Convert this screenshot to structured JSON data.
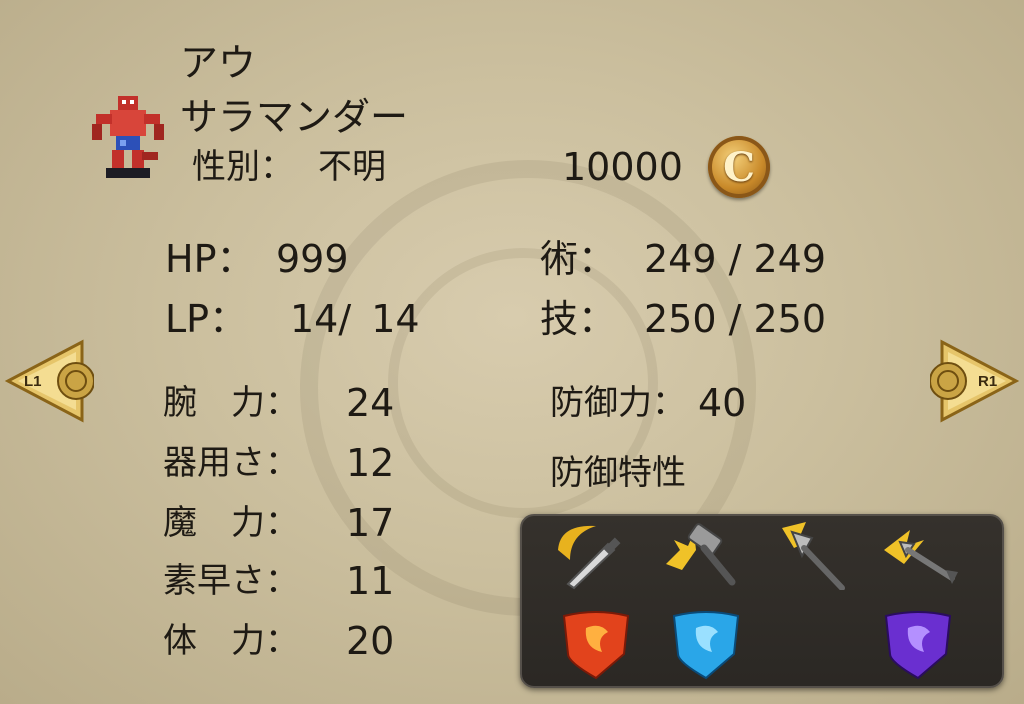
{
  "character": {
    "name": "アウ",
    "race": "サラマンダー",
    "gender_label": "性別：",
    "gender_value": "不明",
    "sprite_icon": "salamander-sprite-icon"
  },
  "money": {
    "value": "10000",
    "icon": "crown-coin-icon",
    "coin_letter": "C"
  },
  "stats": {
    "hp_label": "HP：",
    "hp_value": "999",
    "lp_label": "LP：",
    "lp_value": "14/ 14",
    "jutsu_label": "術：",
    "jutsu_value": "249 / 249",
    "waza_label": "技：",
    "waza_value": "250 / 250",
    "arm_label": "腕　力：",
    "arm_value": "24",
    "dex_label": "器用さ：",
    "dex_value": "12",
    "mag_label": "魔　力：",
    "mag_value": "17",
    "spd_label": "素早さ：",
    "spd_value": "11",
    "vit_label": "体　力：",
    "vit_value": "20",
    "def_label": "防御力：",
    "def_value": "40",
    "resist_label": "防御特性"
  },
  "nav": {
    "left_label": "L1",
    "right_label": "R1"
  },
  "resistances": {
    "physical": [
      "slash-icon",
      "blunt-icon",
      "pierce-icon",
      "shoot-icon"
    ],
    "elemental": [
      "fire-shield-icon",
      "water-shield-icon",
      "dark-shield-icon"
    ]
  },
  "colors": {
    "fire": "#e2431c",
    "water": "#2aa6e8",
    "dark": "#6a2fd0",
    "gold": "#e8b21e"
  }
}
